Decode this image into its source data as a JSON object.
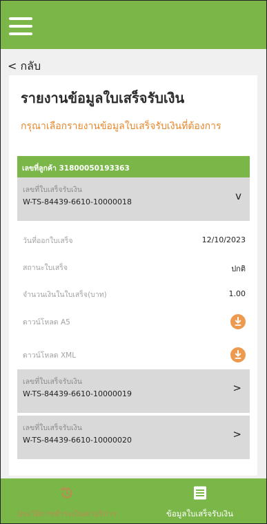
{
  "header": {
    "menu_icon": "hamburger-menu-icon"
  },
  "nav": {
    "back_label": "< กลับ"
  },
  "page": {
    "title": "รายงานข้อมูลใบเสร็จรับเงิน",
    "subtitle": "กรุณาเลือกรายงานข้อมูลใบเสร็จรับเงินที่ต้องการ"
  },
  "customer": {
    "label": "เลขที่ลูกค้า 31800050193363"
  },
  "receipts": [
    {
      "label": "เลขที่ใบเสร็จรับเงิน",
      "number": "W-TS-84439-6610-10000018",
      "chevron": "v",
      "expanded": true
    },
    {
      "label": "เลขที่ใบเสร็จรับเงิน",
      "number": "W-TS-84439-6610-10000019",
      "chevron": ">",
      "expanded": false
    },
    {
      "label": "เลขที่ใบเสร็จรับเงิน",
      "number": "W-TS-84439-6610-10000020",
      "chevron": ">",
      "expanded": false
    }
  ],
  "details": {
    "issue_date_label": "วันที่ออกใบเสร็จ",
    "issue_date_value": "12/10/2023",
    "status_label": "สถานะใบเสร็จ",
    "status_value": "ปกติ",
    "amount_label": "จำนวนเงินในใบเสร็จ(บาท)",
    "amount_value": "1.00",
    "download_a5_label": "ดาวน์โหลด A5",
    "download_xml_label": "ดาวน์โหลด XML",
    "download_icon": "download-icon"
  },
  "bottom_nav": {
    "tab1_label": "ประวัติการชำระเงินค่าบริการ",
    "tab1_icon": "history-icon",
    "tab2_label": "ข้อมูลใบเสร็จรับเงิน",
    "tab2_icon": "receipt-list-icon"
  },
  "colors": {
    "brand_green": "#7ab648",
    "accent_orange": "#e8872a",
    "download_orange": "#ee9a4e",
    "receipt_header_gray": "#d9d9d9"
  }
}
